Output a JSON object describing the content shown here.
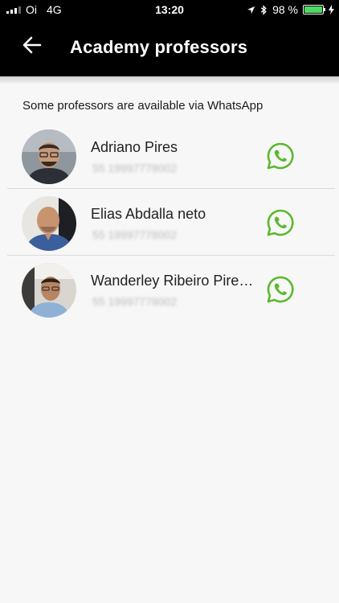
{
  "status_bar": {
    "carrier": "Oi",
    "network": "4G",
    "time": "13:20",
    "battery": "98 %",
    "battery_level": 0.98,
    "icons": [
      "signal-bars-icon",
      "location-arrow-icon",
      "bluetooth-icon",
      "battery-icon",
      "charging-bolt-icon"
    ]
  },
  "header": {
    "title": "Academy professors",
    "back_icon": "back-arrow-icon",
    "background": "#000000"
  },
  "note": "Some professors are available via WhatsApp",
  "professors": [
    {
      "name": "Adriano Pires",
      "phone": "55 19997778002"
    },
    {
      "name": "Elias Abdalla neto",
      "phone": "55 19997778002"
    },
    {
      "name": "Wanderley Ribeiro Pires...",
      "phone": "55 19997778002"
    }
  ],
  "colors": {
    "whatsapp": "#5cb82e",
    "accent_battery": "#4cd964"
  }
}
